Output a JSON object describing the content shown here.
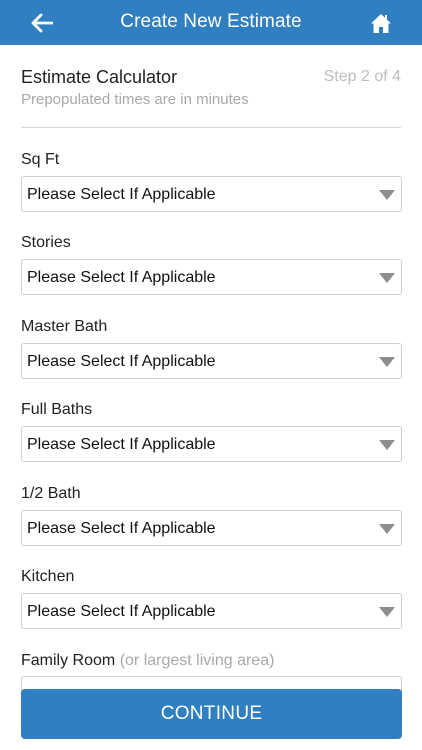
{
  "header": {
    "title": "Create New Estimate",
    "background_color": "#2f7fc1",
    "back_icon": "arrow-left-icon",
    "home_icon": "home-icon"
  },
  "calculator": {
    "title": "Estimate Calculator",
    "subtitle": "Prepopulated times are in minutes",
    "step": "Step 2 of 4"
  },
  "fields": [
    {
      "label": "Sq Ft",
      "value": "Please Select If Applicable"
    },
    {
      "label": "Stories",
      "value": "Please Select If Applicable"
    },
    {
      "label": "Master Bath",
      "value": "Please Select If Applicable"
    },
    {
      "label": "Full Baths",
      "value": "Please Select If Applicable"
    },
    {
      "label": "1/2 Bath",
      "value": "Please Select If Applicable"
    },
    {
      "label": "Kitchen",
      "value": "Please Select If Applicable"
    },
    {
      "label": "Family Room",
      "hint": "(or largest living area)"
    }
  ],
  "continue_label": "CONTINUE",
  "accent_color": "#2f7fc1"
}
